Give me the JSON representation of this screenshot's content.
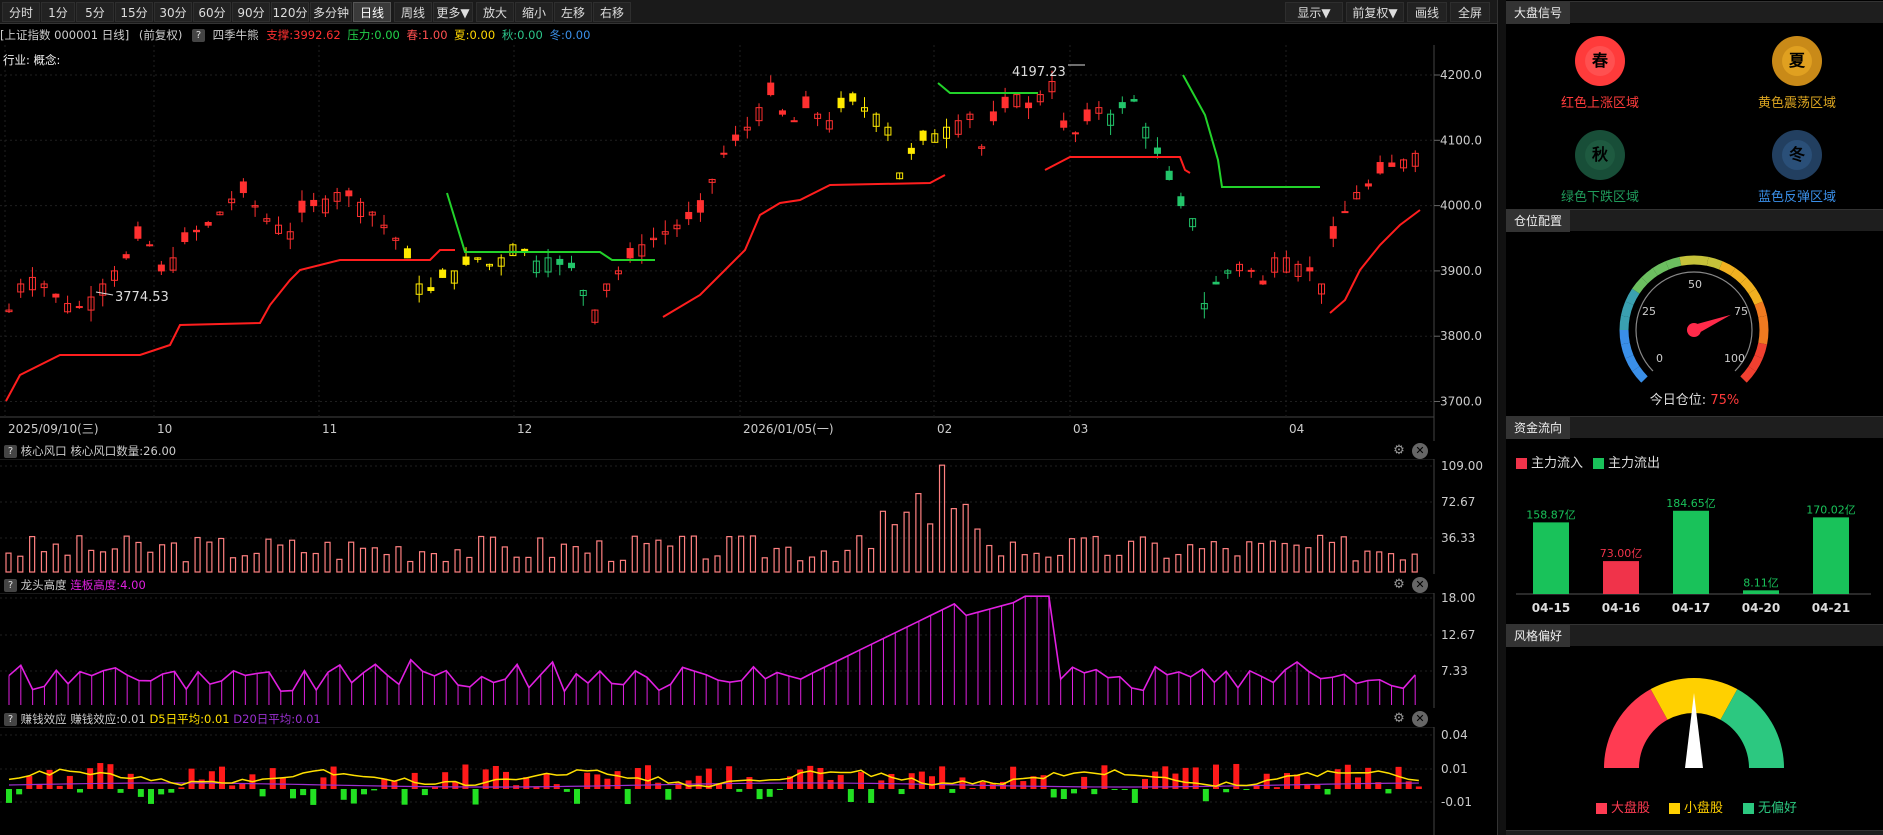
{
  "toolbar": {
    "periods": [
      "分时",
      "1分",
      "5分",
      "15分",
      "30分",
      "60分",
      "90分",
      "120分",
      "多分钟",
      "日线",
      "周线",
      "更多▼",
      "放大",
      "缩小",
      "左移",
      "右移"
    ],
    "active_period": "日线",
    "right_buttons": [
      "显示▼",
      "前复权▼",
      "画线",
      "全屏"
    ]
  },
  "info_bar": {
    "symbol": "[上证指数 000001 日线]",
    "adjust": "(前复权)",
    "help": "?",
    "indicator": "四季牛熊",
    "support": "支撑:3992.62",
    "pressure": "压力:0.00",
    "spring": "春:1.00",
    "summer": "夏:0.00",
    "autumn": "秋:0.00",
    "winter": "冬:0.00"
  },
  "main_chart": {
    "industry_label": "行业: 概念:",
    "high_label": "4197.23",
    "low_label": "3774.53",
    "y_ticks": [
      "4200.0",
      "4100.0",
      "4000.0",
      "3900.0",
      "3800.0",
      "3700.0"
    ],
    "x_labels": [
      "2025/09/10(三)",
      "10",
      "11",
      "12",
      "2026/01/05(一)",
      "02",
      "03",
      "04"
    ]
  },
  "panel1": {
    "help": "?",
    "name": "核心风口",
    "value": "核心风口数量:26.00",
    "y_ticks": [
      "109.00",
      "72.67",
      "36.33"
    ]
  },
  "panel2": {
    "help": "?",
    "name": "龙头高度",
    "value": "连板高度:4.00",
    "y_ticks": [
      "18.00",
      "12.67",
      "7.33"
    ]
  },
  "panel3": {
    "help": "?",
    "name": "赚钱效应",
    "value": "赚钱效应:0.01",
    "d5": "D5日平均:0.01",
    "d20": "D20日平均:0.01",
    "y_ticks": [
      "0.04",
      "0.01",
      "-0.01"
    ]
  },
  "panel_icons": {
    "settings": "⚙",
    "close": "✕"
  },
  "sidebar": {
    "signal_title": "大盘信号",
    "seasons": [
      {
        "char": "春",
        "label": "红色上涨区域",
        "color": "#ff3b3b"
      },
      {
        "char": "夏",
        "label": "黄色震荡区域",
        "color": "#d9a320"
      },
      {
        "char": "秋",
        "label": "绿色下跌区域",
        "color": "#1a6e4a"
      },
      {
        "char": "冬",
        "label": "蓝色反弹区域",
        "color": "#2d5a8a"
      }
    ],
    "position_title": "仓位配置",
    "gauge_ticks": [
      "0",
      "25",
      "50",
      "75",
      "100"
    ],
    "position_label": "今日仓位:",
    "position_value": "75%",
    "position_fraction": 0.75,
    "flow_title": "资金流向",
    "flow_in_label": "主力流入",
    "flow_out_label": "主力流出",
    "style_title": "风格偏好",
    "style_legend": [
      "大盘股",
      "小盘股",
      "无偏好"
    ]
  },
  "chart_data": {
    "type": "bar",
    "categories": [
      "04-15",
      "04-16",
      "04-17",
      "04-20",
      "04-21"
    ],
    "values": [
      158.87,
      73.0,
      184.65,
      8.11,
      170.02
    ],
    "value_labels": [
      "158.87亿",
      "73.00亿",
      "184.65亿",
      "8.11亿",
      "170.02亿"
    ],
    "directions": [
      "out",
      "in",
      "out",
      "out",
      "out"
    ]
  }
}
